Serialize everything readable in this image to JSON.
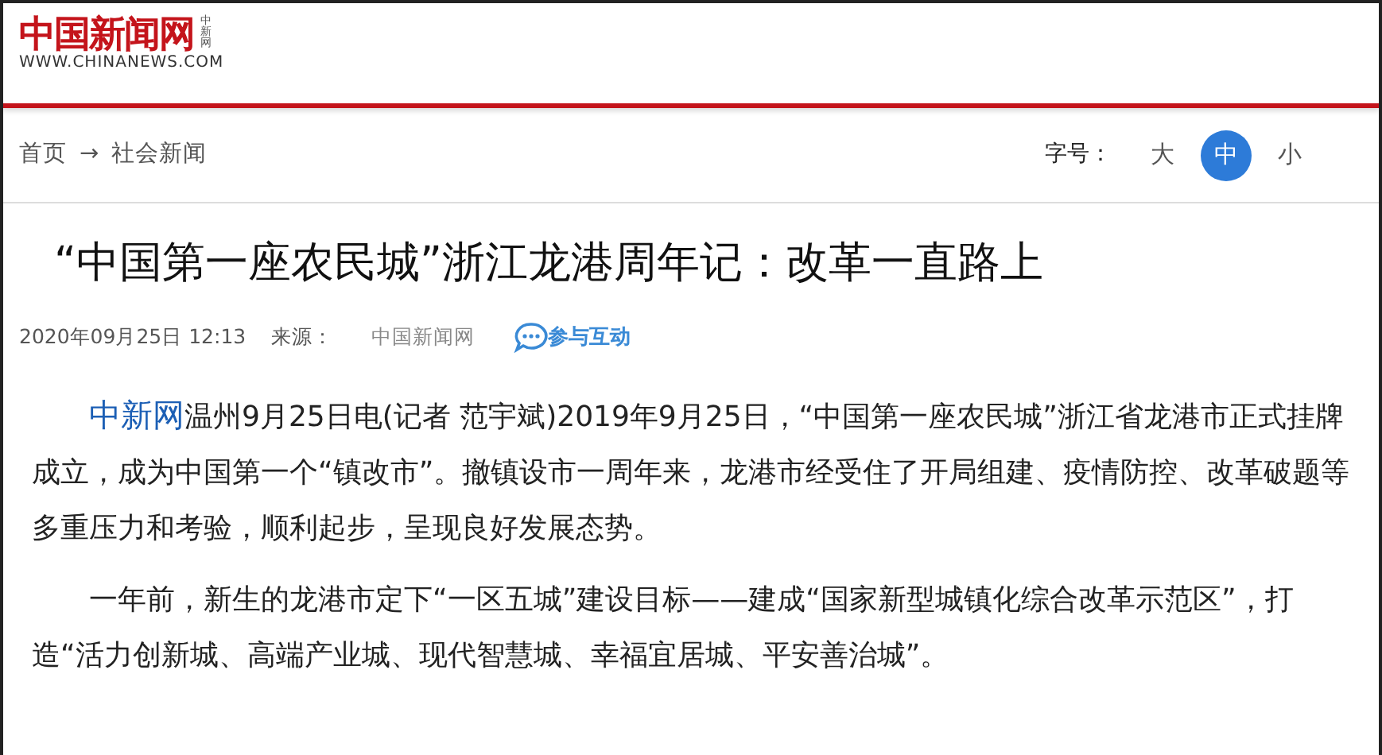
{
  "logo": {
    "name": "中国新闻网",
    "side_mark": "中新网",
    "url": "WWW.CHINANEWS.COM"
  },
  "breadcrumb": {
    "home": "首页",
    "arrow": "→",
    "section": "社会新闻"
  },
  "font_size": {
    "label": "字号：",
    "options": [
      {
        "label": "大",
        "selected": false
      },
      {
        "label": "中",
        "selected": true
      },
      {
        "label": "小",
        "selected": false
      }
    ]
  },
  "article": {
    "title": "“中国第一座农民城”浙江龙港周年记：改革一直路上",
    "datetime": "2020年09月25日 12:13",
    "source_label": "来源：",
    "source": "中国新闻网",
    "interact": "参与互动",
    "paragraphs": [
      {
        "lead_link": "中新网",
        "text": "温州9月25日电(记者 范宇斌)2019年9月25日，“中国第一座农民城”浙江省龙港市正式挂牌成立，成为中国第一个“镇改市”。撤镇设市一周年来，龙港市经受住了开局组建、疫情防控、改革破题等多重压力和考验，顺利起步，呈现良好发展态势。"
      },
      {
        "text": "一年前，新生的龙港市定下“一区五城”建设目标——建成“国家新型城镇化综合改革示范区”，打造“活力创新城、高端产业城、现代智慧城、幸福宜居城、平安善治城”。"
      }
    ]
  }
}
